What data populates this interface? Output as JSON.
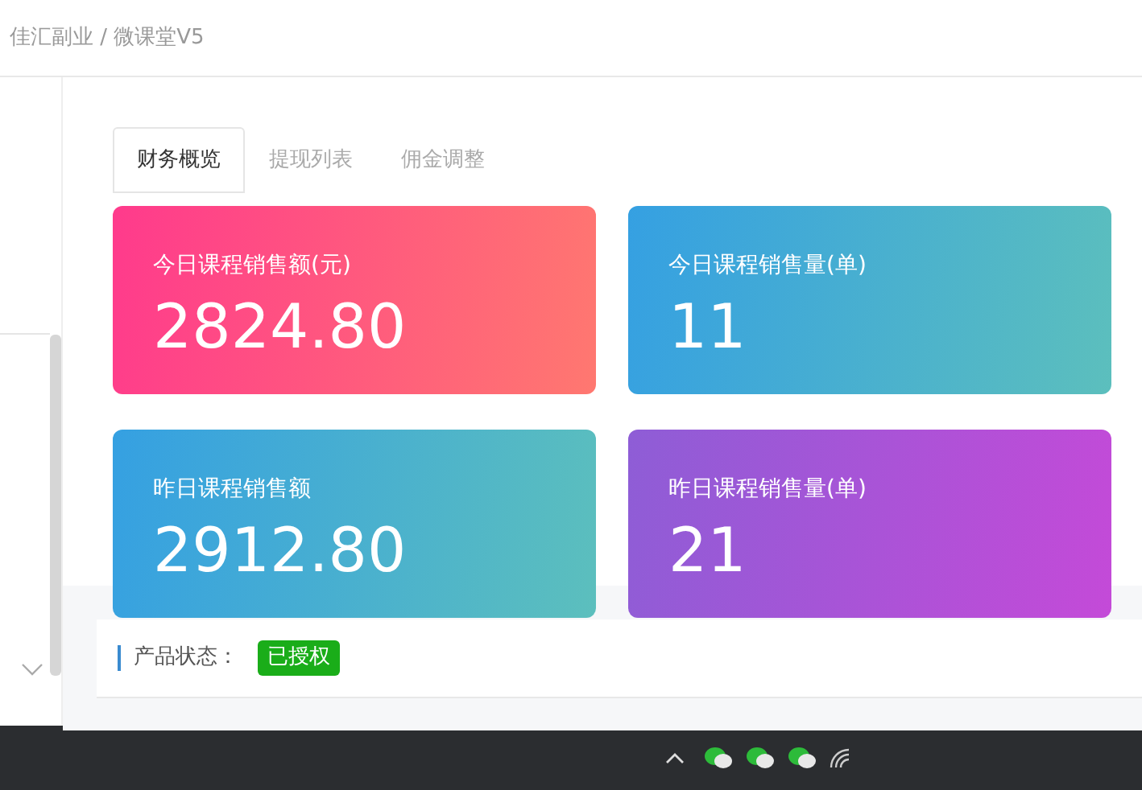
{
  "breadcrumb": "佳汇副业 / 微课堂V5",
  "tabs": [
    {
      "label": "财务概览",
      "selected": true
    },
    {
      "label": "提现列表",
      "selected": false
    },
    {
      "label": "佣金调整",
      "selected": false
    }
  ],
  "stats": [
    {
      "label": "今日课程销售额(元)",
      "value": "2824.80",
      "kind": "rose"
    },
    {
      "label": "今日课程销售量(单)",
      "value": "11",
      "kind": "teal"
    },
    {
      "label": "昨日课程销售额",
      "value": "2912.80",
      "kind": "teal"
    },
    {
      "label": "昨日课程销售量(单)",
      "value": "21",
      "kind": "violet"
    }
  ],
  "status": {
    "label": "产品状态：",
    "badge": "已授权"
  }
}
